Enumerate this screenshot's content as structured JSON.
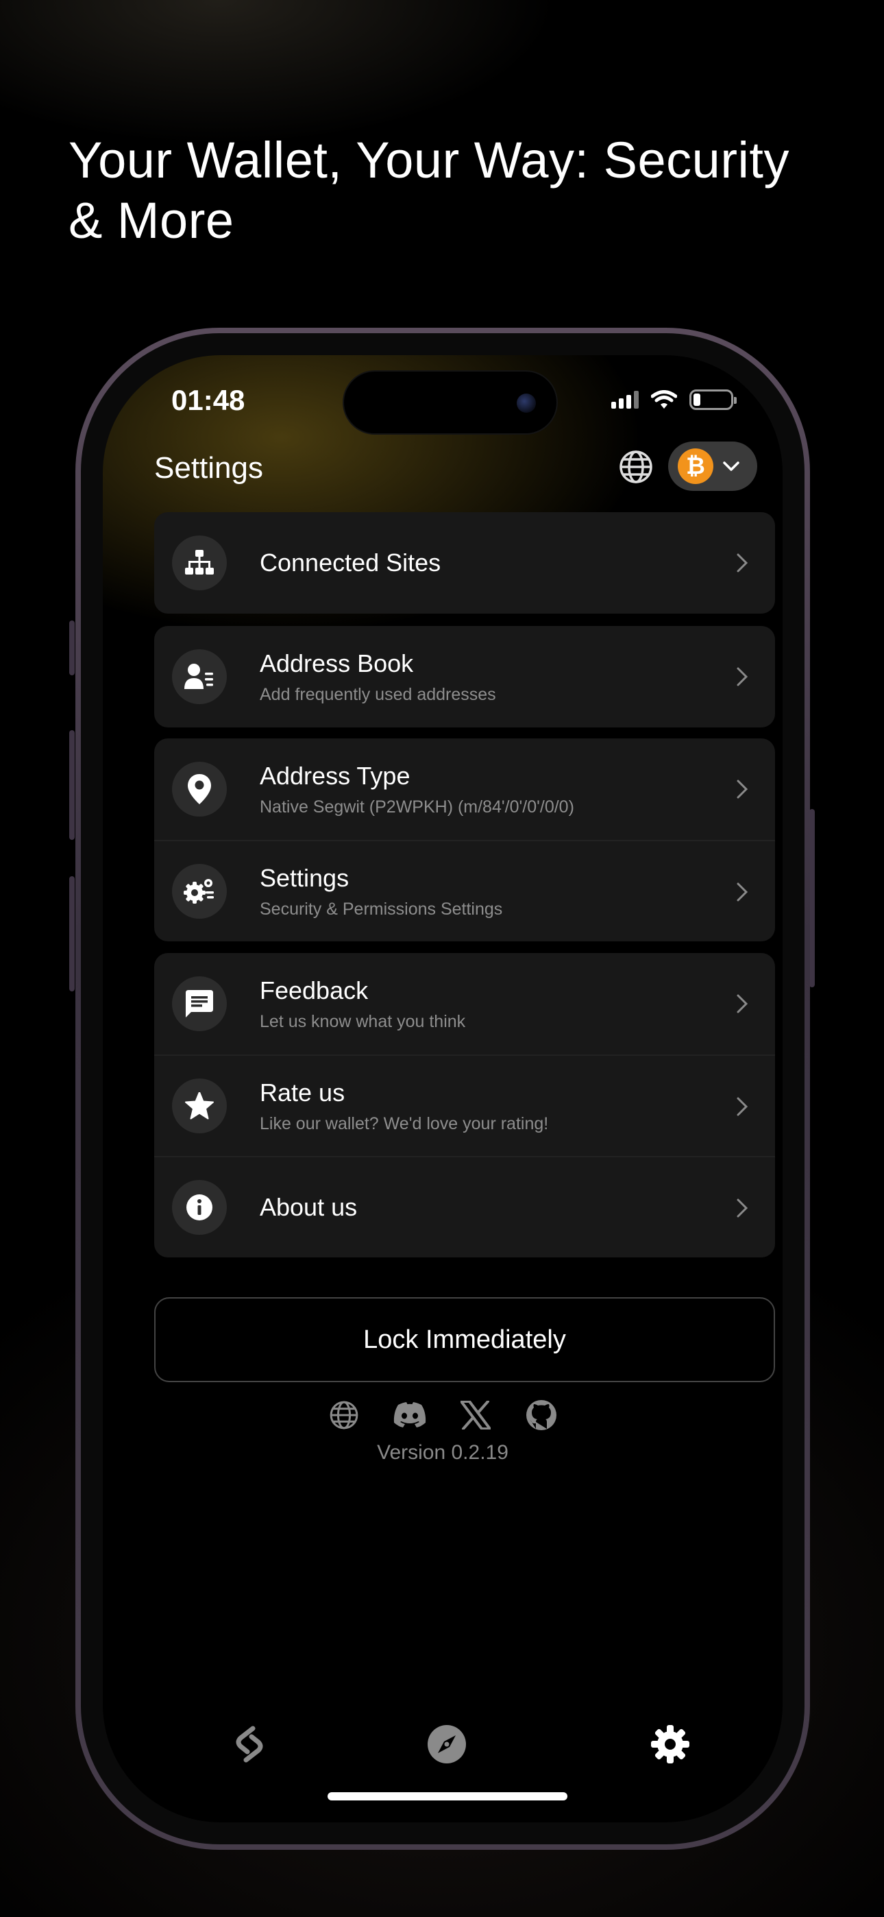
{
  "headline": "Your Wallet, Your Way: Security & More",
  "status": {
    "time": "01:48"
  },
  "header": {
    "title": "Settings",
    "chain_symbol": "₿"
  },
  "groups": [
    [
      {
        "id": "connected-sites",
        "title": "Connected Sites",
        "subtitle": "",
        "icon": "sitemap-icon"
      }
    ],
    [
      {
        "id": "address-book",
        "title": "Address Book",
        "subtitle": "Add frequently used addresses",
        "icon": "contact-book-icon"
      }
    ],
    [
      {
        "id": "address-type",
        "title": "Address Type",
        "subtitle": "Native Segwit (P2WPKH) (m/84'/0'/0'/0/0)",
        "icon": "location-pin-icon"
      },
      {
        "id": "settings",
        "title": "Settings",
        "subtitle": "Security & Permissions Settings",
        "icon": "gears-icon"
      }
    ],
    [
      {
        "id": "feedback",
        "title": "Feedback",
        "subtitle": "Let us know what you think",
        "icon": "chat-bubble-icon"
      },
      {
        "id": "rate-us",
        "title": "Rate us",
        "subtitle": "Like our wallet? We'd love your rating!",
        "icon": "star-icon"
      },
      {
        "id": "about-us",
        "title": "About us",
        "subtitle": "",
        "icon": "info-icon"
      }
    ]
  ],
  "lock_button": "Lock Immediately",
  "socials": [
    "globe-icon",
    "discord-icon",
    "x-icon",
    "github-icon"
  ],
  "version": "Version 0.2.19",
  "tabs": [
    "wallet-tab-icon",
    "explore-compass-icon",
    "settings-gear-icon"
  ],
  "colors": {
    "accent_btc": "#f2931c",
    "card_bg": "#181818",
    "icon_bg": "#2c2c2c",
    "muted_text": "#8e8e8e"
  }
}
